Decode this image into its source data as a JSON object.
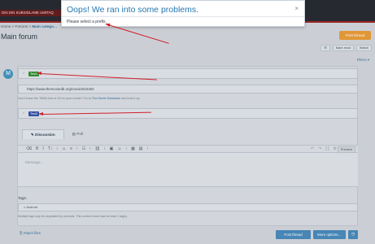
{
  "topbar": {
    "banner_text": "DIN DIN KUBSIDLAME UMITAQ"
  },
  "breadcrumb": {
    "home": "Home",
    "sep": ">",
    "forums": "Forums",
    "category": "Main catego…"
  },
  "page": {
    "title": "Main forum"
  },
  "actions": {
    "post_thread": "Post thread",
    "mark_read": "Mark read",
    "watch": "Watch",
    "filters": "Filters ▾"
  },
  "avatar": {
    "letter": "M"
  },
  "prefixes": [
    {
      "x": "×",
      "label": "Test1",
      "color": "#2a8a2a"
    },
    {
      "x": "×",
      "label": "Test2",
      "color": "#2c4aa0"
    }
  ],
  "url_field": {
    "value": "https://www.themoviedb.org/movie/615302"
  },
  "helper": {
    "text": "Don't know the TMDb link or ID for your movie? Go to ",
    "link": "The Movie Database",
    "tail": " and look it up."
  },
  "tabs": [
    {
      "label": "Discussion"
    },
    {
      "label": "Poll"
    }
  ],
  "toolbar": {
    "preview": "Preview",
    "left_icons": [
      "⌫",
      "B",
      "I",
      "T↕",
      "⁝",
      "☺",
      "≡",
      "⁝",
      "☷",
      "⁝",
      "⛓",
      "⁝",
      "▣",
      "☺",
      "⁝",
      "▦",
      "▤",
      "⁝"
    ],
    "right_icons": [
      "↶",
      "↷",
      "[ ]",
      "⚙"
    ]
  },
  "editor": {
    "placeholder": "Message…"
  },
  "tags": {
    "label": "Tags:",
    "value": "× Android",
    "help": "Multiple tags may be separated by commas. This content must have at least 1 tag(s)."
  },
  "footer": {
    "attach": "⎘ Attach files",
    "post_thread": "Post thread",
    "more_options": "More options…",
    "clock": "◷"
  },
  "modal": {
    "title": "Oops! We ran into some problems.",
    "close": "×",
    "message": "Please select a prefix."
  },
  "colors": {
    "accent": "#2577b1",
    "arrow": "#d3151f",
    "orange": "#e8962c"
  }
}
